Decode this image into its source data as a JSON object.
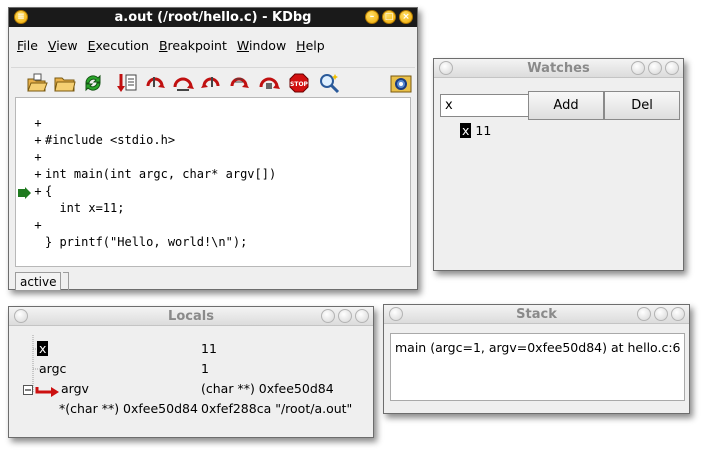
{
  "main_window": {
    "title": "a.out (/root/hello.c) - KDbg",
    "menu": [
      "File",
      "View",
      "Execution",
      "Breakpoint",
      "Window",
      "Help"
    ],
    "toolbar_icons": [
      "executable-open-icon",
      "source-open-icon",
      "reload-icon",
      "program-run-icon",
      "step-into-icon",
      "step-over-icon",
      "step-out-icon",
      "run-to-cursor-icon",
      "step-instruction-icon",
      "break-stop-icon",
      "find-icon",
      "settings-gear-icon"
    ],
    "code_lines": [
      {
        "marker": "+",
        "text": "#include <stdio.h>"
      },
      {
        "marker": "+",
        "text": ""
      },
      {
        "marker": "+",
        "text": "int main(int argc, char* argv[])"
      },
      {
        "marker": "+",
        "text": "{"
      },
      {
        "marker": "+",
        "text": "  int x=11;"
      },
      {
        "marker": "+",
        "text": "  printf(\"Hello, world!\\n\");"
      },
      {
        "marker": "+",
        "text": "}"
      }
    ],
    "status": "active"
  },
  "watches": {
    "title": "Watches",
    "input_value": "x",
    "add_label": "Add",
    "del_label": "Del",
    "items": [
      {
        "name": "x",
        "value": "11"
      }
    ]
  },
  "locals": {
    "title": "Locals",
    "rows": [
      {
        "name": "x",
        "value": "11"
      },
      {
        "name": "argc",
        "value": "1"
      },
      {
        "name": "argv",
        "value": "(char **) 0xfee50d84"
      },
      {
        "name": "*(char **) 0xfee50d84",
        "value": "0xfef288ca \"/root/a.out\""
      }
    ]
  },
  "stack": {
    "title": "Stack",
    "frames": [
      "main (argc=1, argv=0xfee50d84) at hello.c:6"
    ]
  },
  "colors": {
    "pc_marker": "#1f7a1f",
    "titlebar_active": "#1a1a1a",
    "pointer_red": "#cc1010"
  }
}
